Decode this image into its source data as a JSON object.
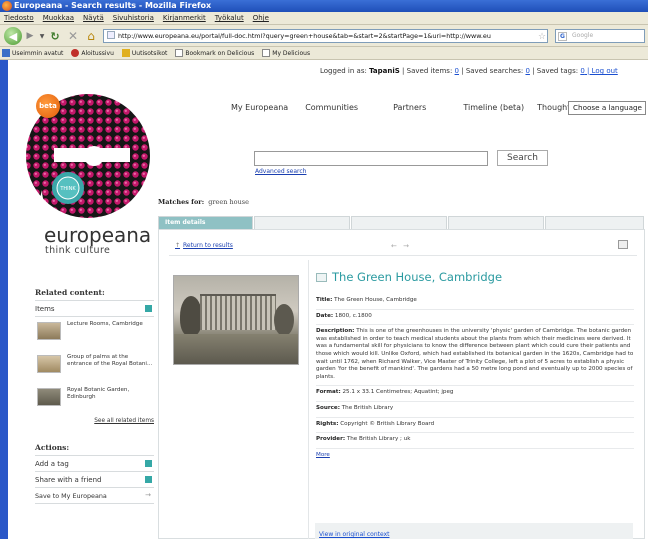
{
  "window": {
    "title": "Europeana - Search results - Mozilla Firefox"
  },
  "menu": [
    "Tiedosto",
    "Muokkaa",
    "Näytä",
    "Sivuhistoria",
    "Kirjanmerkit",
    "Työkalut",
    "Ohje"
  ],
  "address_bar": {
    "url": "http://www.europeana.eu/portal/full-doc.html?query=green+house&tab=&start=2&startPage=1&uri=http://www.eu",
    "search_placeholder": "Google"
  },
  "bookmarks": [
    "Useimmin avatut",
    "Aloitussivu",
    "Uutisotsikot",
    "Bookmark on Delicious",
    "My Delicious"
  ],
  "login": {
    "prefix": "Logged in as: ",
    "user": "TapaniS",
    "saved_items": " | Saved items: ",
    "saved_searches": " | Saved searches: ",
    "saved_tags": " | Saved tags: ",
    "zero": "0",
    "logout": " | Log out"
  },
  "logo": {
    "badge": "beta",
    "word": "europeana",
    "tagline": "think culture"
  },
  "topnav": [
    "My Europeana",
    "Communities",
    "Partners",
    "Timeline (beta)",
    "Thought lab"
  ],
  "language": {
    "label": "Choose a language"
  },
  "search": {
    "button": "Search",
    "advanced": "Advanced search",
    "value": ""
  },
  "matches": {
    "label": "Matches for:",
    "query": "green house"
  },
  "tabs": {
    "active": "Item details"
  },
  "item": {
    "return_link": "Return to results",
    "nav_arrows": "← →",
    "title": "The Green House, Cambridge",
    "fields": [
      {
        "label": "Title:",
        "value": " The Green House, Cambridge"
      },
      {
        "label": "Date:",
        "value": " 1800, c.1800"
      },
      {
        "label": "Description:",
        "value": " This is one of the greenhouses in the university 'physic' garden of Cambridge. The botanic garden was established in order to teach medical students about the plants from which their medicines were derived. It was a fundamental skill for physicians to know the difference between plant which could cure their patients and those which would kill. Unlike Oxford, which had established its botanical garden in the 1620s, Cambridge had to wait until 1762, when Richard Walker, Vice Master of Trinity College, left a plot of 5 acres to establish a physic garden 'for the benefit of mankind'. The gardens had a 50 metre long pond and eventually up to 2000 species of plants."
      },
      {
        "label": "Format:",
        "value": " 25.1 x 33.1 Centimetres; Aquatint; jpeg"
      },
      {
        "label": "Source:",
        "value": " The British Library"
      },
      {
        "label": "Rights:",
        "value": " Copyright © British Library Board"
      },
      {
        "label": "Provider:",
        "value": " The British Library ; uk"
      }
    ],
    "more": "More",
    "view_original": "View in original context"
  },
  "related": {
    "heading": "Related content:",
    "items_label": "Items",
    "items": [
      "Lecture Rooms, Cambridge",
      "Group of palms at the entrance of the Royal Botani...",
      "Royal Botanic Garden, Edinburgh"
    ],
    "see_all": "See all related items"
  },
  "actions": {
    "heading": "Actions:",
    "list": [
      "Add a tag",
      "Share with a friend",
      "Save to My Europeana"
    ]
  },
  "colors": {
    "accent": "#2a9aa0",
    "tab_active": "#8fc1c4",
    "link": "#1a3fb0",
    "titlebar": "#1f4fb8"
  }
}
